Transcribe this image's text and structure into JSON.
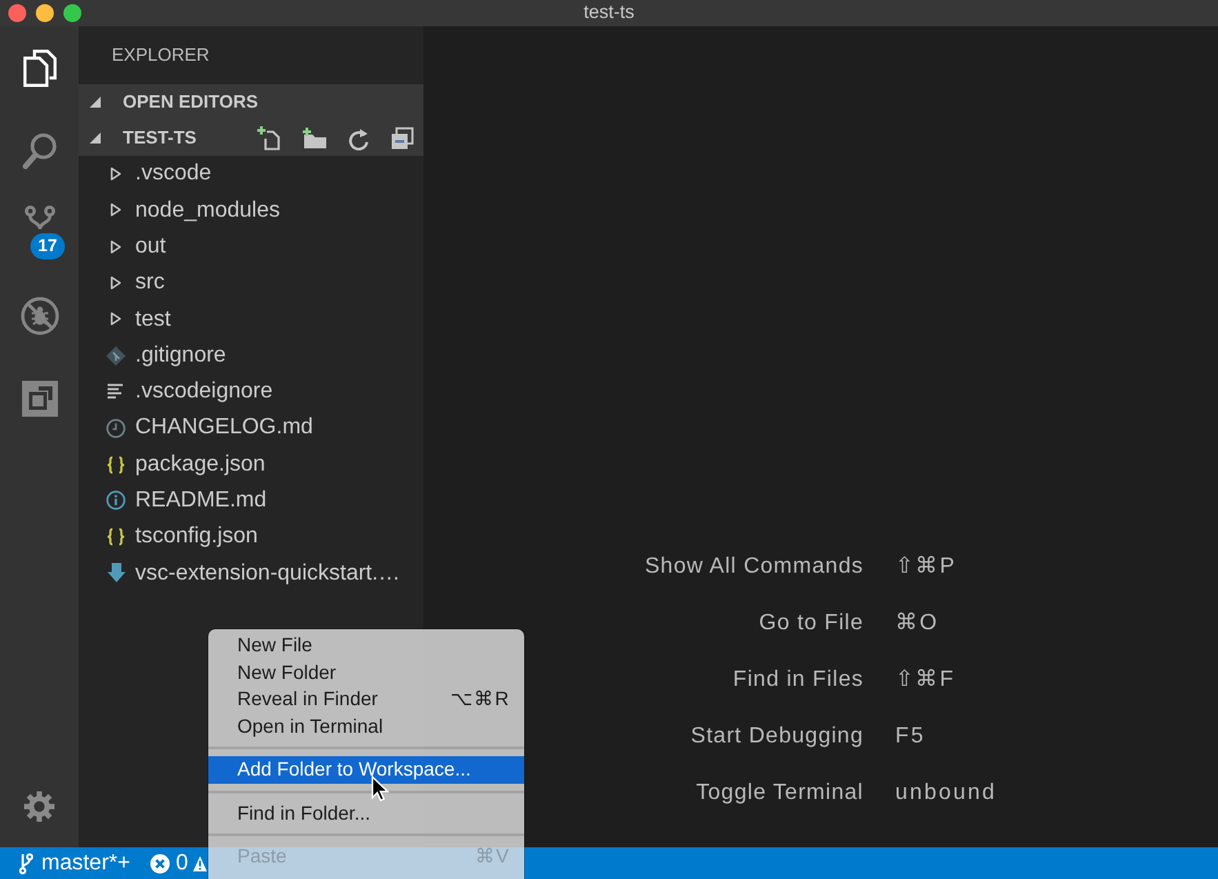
{
  "window": {
    "title": "test-ts"
  },
  "activity_bar": {
    "items": [
      {
        "kind": "files",
        "selected": true
      },
      {
        "kind": "search",
        "selected": false
      },
      {
        "kind": "source_control",
        "selected": false,
        "badge": "17"
      },
      {
        "kind": "debug",
        "selected": false
      },
      {
        "kind": "extensions",
        "selected": false
      }
    ]
  },
  "sidebar": {
    "title": "EXPLORER",
    "sections": [
      {
        "title": "OPEN EDITORS",
        "expanded": true
      },
      {
        "title": "TEST-TS",
        "expanded": true,
        "toolbar": true,
        "children": [
          {
            "name": ".vscode",
            "kind": "folder",
            "expanded": false
          },
          {
            "name": "node_modules",
            "kind": "folder",
            "expanded": false
          },
          {
            "name": "out",
            "kind": "folder",
            "expanded": false
          },
          {
            "name": "src",
            "kind": "folder",
            "expanded": false
          },
          {
            "name": "test",
            "kind": "folder",
            "expanded": false
          },
          {
            "name": ".gitignore",
            "kind": "git"
          },
          {
            "name": ".vscodeignore",
            "kind": "ignore"
          },
          {
            "name": "CHANGELOG.md",
            "kind": "changelog"
          },
          {
            "name": "package.json",
            "kind": "json"
          },
          {
            "name": "README.md",
            "kind": "readme"
          },
          {
            "name": "tsconfig.json",
            "kind": "json"
          },
          {
            "name": "vsc-extension-quickstart.…",
            "kind": "markdown"
          }
        ]
      }
    ]
  },
  "editor": {
    "shortcuts": [
      {
        "label": "Show All Commands",
        "keys": "⇧⌘P"
      },
      {
        "label": "Go to File",
        "keys": "⌘O"
      },
      {
        "label": "Find in Files",
        "keys": "⇧⌘F"
      },
      {
        "label": "Start Debugging",
        "keys": "F5"
      },
      {
        "label": "Toggle Terminal",
        "keys": "unbound"
      }
    ]
  },
  "context_menu": {
    "groups": [
      {
        "items": [
          {
            "label": "New File",
            "selected": false,
            "disabled": false
          },
          {
            "label": "New Folder",
            "selected": false,
            "disabled": false
          },
          {
            "label": "Reveal in Finder",
            "shortcut": "⌥⌘R",
            "selected": false,
            "disabled": false
          },
          {
            "label": "Open in Terminal",
            "selected": false,
            "disabled": false
          }
        ]
      },
      {
        "items": [
          {
            "label": "Add Folder to Workspace...",
            "selected": true,
            "disabled": false
          }
        ]
      },
      {
        "items": [
          {
            "label": "Find in Folder...",
            "selected": false,
            "disabled": false
          }
        ]
      },
      {
        "items": [
          {
            "label": "Paste",
            "shortcut": "⌘V",
            "selected": false,
            "disabled": true
          }
        ]
      }
    ]
  },
  "status_bar": {
    "branch": "master*+",
    "errors": "0"
  }
}
